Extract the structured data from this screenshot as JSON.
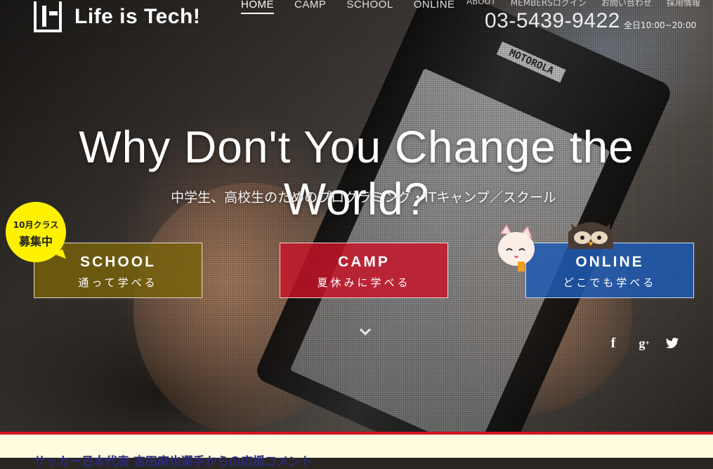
{
  "header": {
    "logo_text": "Life is Tech!",
    "nav_main": [
      "HOME",
      "CAMP",
      "SCHOOL",
      "ONLINE"
    ],
    "nav_sub": [
      "ABOUT",
      "MEMBERSログイン",
      "お問い合わせ",
      "採用情報"
    ],
    "phone": "03-5439-9422",
    "hours": "全日10:00~20:00"
  },
  "hero": {
    "headline": "Why Don't You Change the World?",
    "subhead": "中学生、高校生のためのプログラミング・ITキャンプ／スクール",
    "phone_label": "MOTOROLA"
  },
  "badge": {
    "line1": "10月クラス",
    "line2": "募集中"
  },
  "cta": [
    {
      "title": "SCHOOL",
      "subtitle": "通って学べる"
    },
    {
      "title": "CAMP",
      "subtitle": "夏休みに学べる"
    },
    {
      "title": "ONLINE",
      "subtitle": "どこでも学べる"
    }
  ],
  "social_icons": [
    "facebook-icon",
    "google-plus-icon",
    "twitter-icon"
  ],
  "footer": {
    "text": "サッカー日本代表 吉田麻也選手からの応援コメント"
  },
  "colors": {
    "school": "#7a620a",
    "camp": "#c81428",
    "online": "#1e5ab4",
    "badge": "#fff100",
    "footer_border": "#d4151e"
  }
}
